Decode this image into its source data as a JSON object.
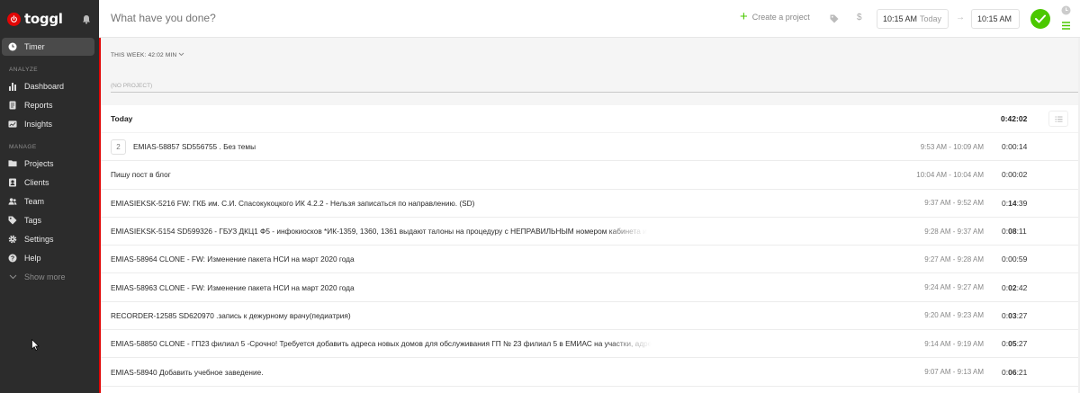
{
  "brand": {
    "name": "toggl"
  },
  "sidebar": {
    "timer_label": "Timer",
    "analyze_label": "ANALYZE",
    "analyze_items": [
      {
        "label": "Dashboard",
        "icon": "bar-chart-icon"
      },
      {
        "label": "Reports",
        "icon": "document-icon"
      },
      {
        "label": "Insights",
        "icon": "insights-icon"
      }
    ],
    "manage_label": "MANAGE",
    "manage_items": [
      {
        "label": "Projects",
        "icon": "folder-icon"
      },
      {
        "label": "Clients",
        "icon": "person-card-icon"
      },
      {
        "label": "Team",
        "icon": "team-icon"
      },
      {
        "label": "Tags",
        "icon": "tag-icon"
      },
      {
        "label": "Settings",
        "icon": "gear-icon"
      },
      {
        "label": "Help",
        "icon": "help-icon"
      }
    ],
    "show_more": "Show more"
  },
  "timer_bar": {
    "description_placeholder": "What have you done?",
    "create_project": "Create a project",
    "billable_symbol": "$",
    "start_time": "10:15 AM",
    "start_day": "Today",
    "arrow": "→",
    "end_time": "10:15 AM"
  },
  "week": {
    "label": "THIS WEEK: 42:02 MIN",
    "no_project": "(NO PROJECT)"
  },
  "day": {
    "title": "Today",
    "total": "0:42:02"
  },
  "entries": [
    {
      "count": "2",
      "description": "EMIAS-58857 SD556755 . Без темы",
      "range": "9:53 AM - 10:09 AM",
      "dur_prefix": "0:00:",
      "dur_bold": "",
      "dur_suffix": "14"
    },
    {
      "count": "",
      "description": "Пишу пост в блог",
      "range": "10:04 AM - 10:04 AM",
      "dur_prefix": "0:00:",
      "dur_bold": "",
      "dur_suffix": "02"
    },
    {
      "count": "",
      "description": "EMIASIEKSK-5216 FW: ГКБ им. С.И. Спасокукоцкого ИК 4.2.2 - Нельзя записаться по направлению. (SD)",
      "range": "9:37 AM - 9:52 AM",
      "dur_prefix": "0:",
      "dur_bold": "14",
      "dur_suffix": ":39"
    },
    {
      "count": "",
      "description": "EMIASIEKSK-5154 SD599326 - ГБУЗ ДКЦ1 Ф5 - инфокиосков *ИК-1359, 1360, 1361 выдают талоны на процедуру с НЕПРАВИЛЬНЫМ номером кабинета и",
      "range": "9:28 AM - 9:37 AM",
      "dur_prefix": "0:",
      "dur_bold": "08",
      "dur_suffix": ":11"
    },
    {
      "count": "",
      "description": "EMIAS-58964 CLONE - FW: Изменение пакета НСИ на март 2020 года",
      "range": "9:27 AM - 9:28 AM",
      "dur_prefix": "0:00:",
      "dur_bold": "",
      "dur_suffix": "59"
    },
    {
      "count": "",
      "description": "EMIAS-58963 CLONE - FW: Изменение пакета НСИ на март 2020 года",
      "range": "9:24 AM - 9:27 AM",
      "dur_prefix": "0:",
      "dur_bold": "02",
      "dur_suffix": ":42"
    },
    {
      "count": "",
      "description": "RECORDER-12585 SD620970 .запись к дежурному врачу(педиатрия)",
      "range": "9:20 AM - 9:23 AM",
      "dur_prefix": "0:",
      "dur_bold": "03",
      "dur_suffix": ":27"
    },
    {
      "count": "",
      "description": "EMIAS-58850 CLONE - ГП23 филиал 5 -Срочно! Требуется добавить адреса новых домов для обслуживания ГП № 23 филиал 5 в ЕМИАС на участки, адре",
      "range": "9:14 AM - 9:19 AM",
      "dur_prefix": "0:",
      "dur_bold": "05",
      "dur_suffix": ":27"
    },
    {
      "count": "",
      "description": "EMIAS-58940 Добавить учебное заведение.",
      "range": "9:07 AM - 9:13 AM",
      "dur_prefix": "0:",
      "dur_bold": "06",
      "dur_suffix": ":21"
    }
  ],
  "colors": {
    "brand_red": "#e20505",
    "green": "#4bc800",
    "sidebar_bg": "#2c2c2c"
  }
}
